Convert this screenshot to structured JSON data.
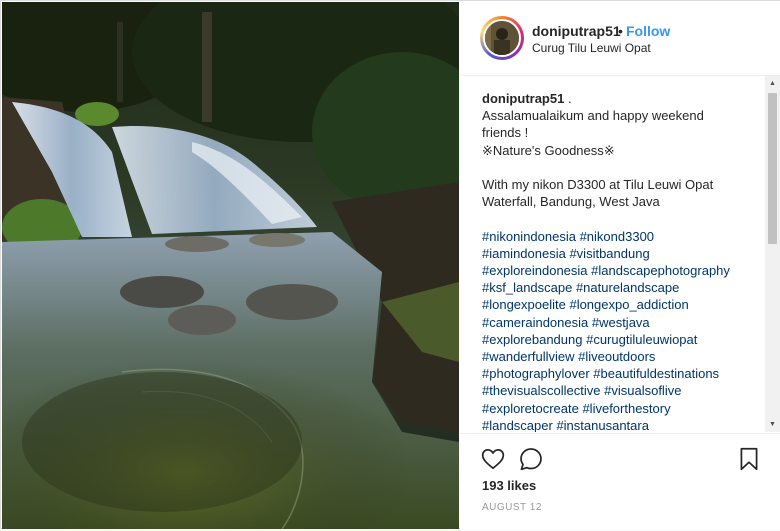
{
  "post": {
    "username": "doniputrap51",
    "dot": "•",
    "follow_label": "Follow",
    "location": "Curug Tilu Leuwi Opat"
  },
  "caption": {
    "username": "doniputrap51",
    "user_suffix": " .",
    "lines": [
      "Assalamualaikum and happy weekend",
      "friends !",
      "※Nature's Goodness※",
      "",
      "With my nikon D3300 at Tilu Leuwi Opat",
      "Waterfall, Bandung, West Java",
      ""
    ],
    "hashtag_lines": [
      "#nikonindonesia #nikond3300",
      "#iamindonesia #visitbandung",
      "#exploreindonesia #landscapephotography",
      "#ksf_landscape #naturelandscape",
      "#longexpoelite #longexpo_addiction",
      "#cameraindonesia #westjava",
      "#explorebandung #curugtiluleuwiopat",
      "#wanderfullview #liveoutdoors",
      "#photographylover #beautifuldestinations",
      "#thevisualscollective #visualsoflive",
      "#exploretocreate #liveforthestory",
      "#landscaper #instanusantara"
    ]
  },
  "icons": {
    "like": "heart-icon",
    "comment": "comment-icon",
    "save": "bookmark-icon",
    "scroll_up": "scroll-up-arrow",
    "scroll_down": "scroll-down-arrow"
  },
  "stats": {
    "likes": "193 likes",
    "date": "AUGUST 12"
  }
}
